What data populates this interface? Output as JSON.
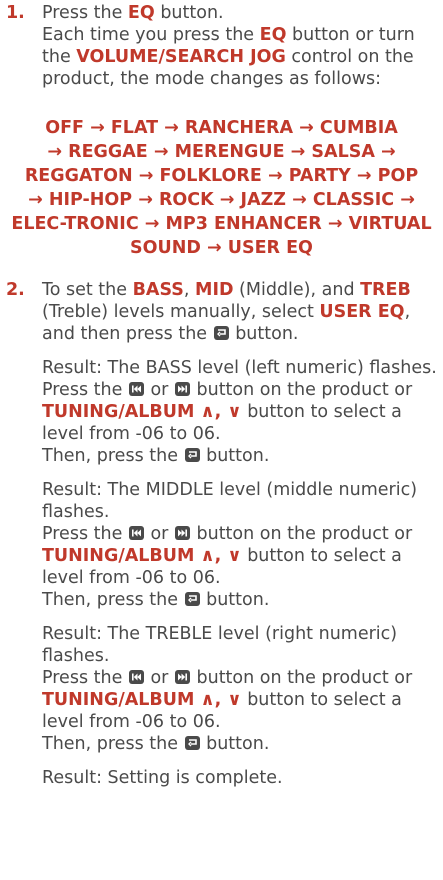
{
  "step1": {
    "number": "1.",
    "line1_pre": "Press the ",
    "line1_eq": "EQ",
    "line1_post": " button.",
    "line2_a": "Each time you press the ",
    "line2_eq": "EQ",
    "line2_b": " button or turn the ",
    "line2_vol": "VOLUME/SEARCH JOG",
    "line2_c": " control on the product, the mode changes as follows:"
  },
  "modes": [
    "OFF → FLAT → RANCHERA → CUMBIA",
    "→ REGGAE → MERENGUE → SALSA →",
    "REGGATON → FOLKLORE → PARTY → POP",
    "→ HIP-HOP → ROCK → JAZZ → CLASSIC →",
    "ELEC-TRONIC → MP3 ENHANCER → VIRTUAL",
    "SOUND → USER EQ"
  ],
  "step2": {
    "number": "2.",
    "intro": {
      "a": "To set the ",
      "bass": "BASS",
      "b": ", ",
      "mid": "MID",
      "c": " (Middle), and ",
      "treb": "TREB",
      "d": " (Treble) levels manually, select ",
      "usereq": "USER EQ",
      "e": ", and then press the ",
      "f": " button."
    },
    "blocks": [
      {
        "result": "Result: The BASS level (left numeric) flashes.",
        "press_a": "Press the ",
        "press_or": " or ",
        "press_b": " button on the product or ",
        "tuning": "TUNING/ALBUM",
        "updown": " ∧, ∨",
        "press_c": " button to select a level from -06 to 06.",
        "then_a": "Then, press the ",
        "then_b": " button."
      },
      {
        "result": "Result: The MIDDLE level (middle numeric) flashes.",
        "press_a": "Press the ",
        "press_or": " or ",
        "press_b": " button on the product or ",
        "tuning": "TUNING/ALBUM",
        "updown": " ∧, ∨",
        "press_c": " button to select a level from -06 to 06.",
        "then_a": "Then, press the ",
        "then_b": " button."
      },
      {
        "result": "Result: The TREBLE level (right numeric) flashes.",
        "press_a": "Press the ",
        "press_or": " or ",
        "press_b": " button on the product or ",
        "tuning": "TUNING/ALBUM",
        "updown": " ∧, ∨",
        "press_c": " button to select a level from -06 to 06.",
        "then_a": "Then, press the ",
        "then_b": " button."
      }
    ],
    "final": "Result: Setting is complete."
  },
  "icons": {
    "enter": "enter-button-icon",
    "prev": "skip-back-icon",
    "next": "skip-forward-icon"
  },
  "colors": {
    "accent": "#c0392b",
    "text": "#4a4a4a"
  }
}
